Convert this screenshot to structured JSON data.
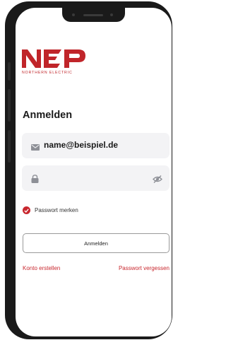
{
  "brand": {
    "logo_text": "NEP",
    "logo_subtext": "NORTHERN ELECTRIC"
  },
  "login": {
    "title": "Anmelden",
    "email_value": "name@beispiel.de",
    "password_value": "",
    "remember_label": "Passwort merken",
    "remember_checked": true,
    "submit_label": "Anmelden",
    "create_account_link": "Konto erstellen",
    "forgot_password_link": "Passwort vergessen"
  },
  "icons": {
    "email": "mail-icon",
    "password": "lock-icon",
    "visibility": "eye-off-icon",
    "remember": "check-icon"
  },
  "colors": {
    "accent": "#c8272e",
    "field_background": "#f3f3f5",
    "text": "#1a1a1a",
    "frame": "#1a1a1a"
  }
}
